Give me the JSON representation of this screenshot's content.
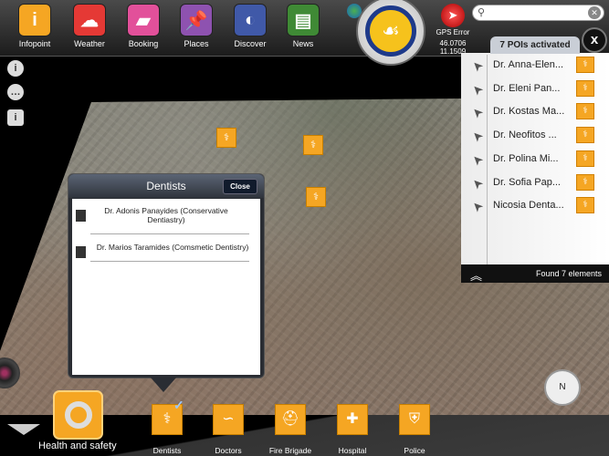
{
  "topbar": {
    "apps": [
      {
        "label": "Infopoint",
        "icon": "info-icon",
        "color": "#f5a623"
      },
      {
        "label": "Weather",
        "icon": "weather-icon",
        "color": "#e53935"
      },
      {
        "label": "Booking",
        "icon": "booking-icon",
        "color": "#e2509a"
      },
      {
        "label": "Places",
        "icon": "pushpin-icon",
        "color": "#8e52b0"
      },
      {
        "label": "Discover",
        "icon": "discover-icon",
        "color": "#4059a8"
      },
      {
        "label": "News",
        "icon": "news-icon",
        "color": "#3f8a35"
      }
    ],
    "gps": {
      "label": "GPS Error",
      "lat": "46.0706",
      "lon": "11.1509"
    },
    "search": {
      "value": ""
    }
  },
  "poi_panel": {
    "header": "7 POIs activated",
    "close": "x",
    "items": [
      "Dr. Anna-Elen...",
      "Dr. Eleni Pan...",
      "Dr. Kostas Ma...",
      "Dr. Neofitos ...",
      "Dr. Polina Mi...",
      "Dr. Sofia Pap...",
      "Nicosia Denta..."
    ],
    "footer": "Found 7 elements"
  },
  "popup": {
    "title": "Dentists",
    "close": "Close",
    "items": [
      "Dr. Adonis Panayides (Conservative Dentiastry)",
      "Dr. Marios Taramides (Comsmetic Dentistry)"
    ]
  },
  "bottom": {
    "group": "Health and safety",
    "categories": [
      {
        "label": "Dentists",
        "icon": "dentist-icon",
        "selected": true
      },
      {
        "label": "Doctors",
        "icon": "stethoscope-icon",
        "selected": false
      },
      {
        "label": "Fire Brigade",
        "icon": "fire-helmet-icon",
        "selected": false
      },
      {
        "label": "Hospital",
        "icon": "hospital-icon",
        "selected": false
      },
      {
        "label": "Police",
        "icon": "police-shield-icon",
        "selected": false
      }
    ]
  },
  "compass": "N",
  "colors": {
    "accent": "#f5a623"
  }
}
